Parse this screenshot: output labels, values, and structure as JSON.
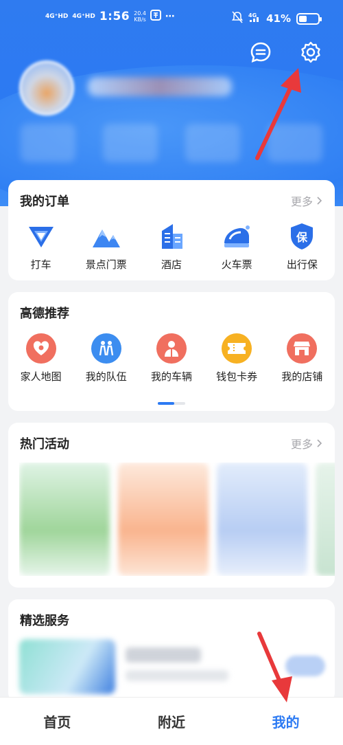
{
  "status_bar": {
    "signal_1": "4G⁺HD",
    "signal_2": "4G⁺HD",
    "time": "1:56",
    "net_speed": "20.4",
    "net_unit": "KB/s",
    "extra": "⋯",
    "battery_percent": "41%",
    "battery_level": 0.41
  },
  "orders": {
    "title": "我的订单",
    "more": "更多",
    "items": [
      {
        "label": "打车",
        "icon": "taxi-icon"
      },
      {
        "label": "景点门票",
        "icon": "mountain-ticket-icon"
      },
      {
        "label": "酒店",
        "icon": "hotel-icon"
      },
      {
        "label": "火车票",
        "icon": "train-icon"
      },
      {
        "label": "出行保",
        "icon": "insurance-shield-icon"
      }
    ]
  },
  "recommend": {
    "title": "高德推荐",
    "items": [
      {
        "label": "家人地图",
        "icon": "family-map-icon",
        "color": "#f06f5f"
      },
      {
        "label": "我的队伍",
        "icon": "team-icon",
        "color": "#3c8df0"
      },
      {
        "label": "我的车辆",
        "icon": "vehicle-icon",
        "color": "#f06f5f"
      },
      {
        "label": "钱包卡券",
        "icon": "wallet-coupon-icon",
        "color": "#f7b122"
      },
      {
        "label": "我的店铺",
        "icon": "shop-icon",
        "color": "#f06f5f"
      }
    ]
  },
  "activities": {
    "title": "热门活动",
    "more": "更多"
  },
  "services": {
    "title": "精选服务"
  },
  "tabbar": {
    "items": [
      {
        "label": "首页",
        "active": false
      },
      {
        "label": "附近",
        "active": false
      },
      {
        "label": "我的",
        "active": true
      }
    ]
  },
  "colors": {
    "brand": "#2c7af3",
    "annotation_arrow": "#e8393b"
  }
}
